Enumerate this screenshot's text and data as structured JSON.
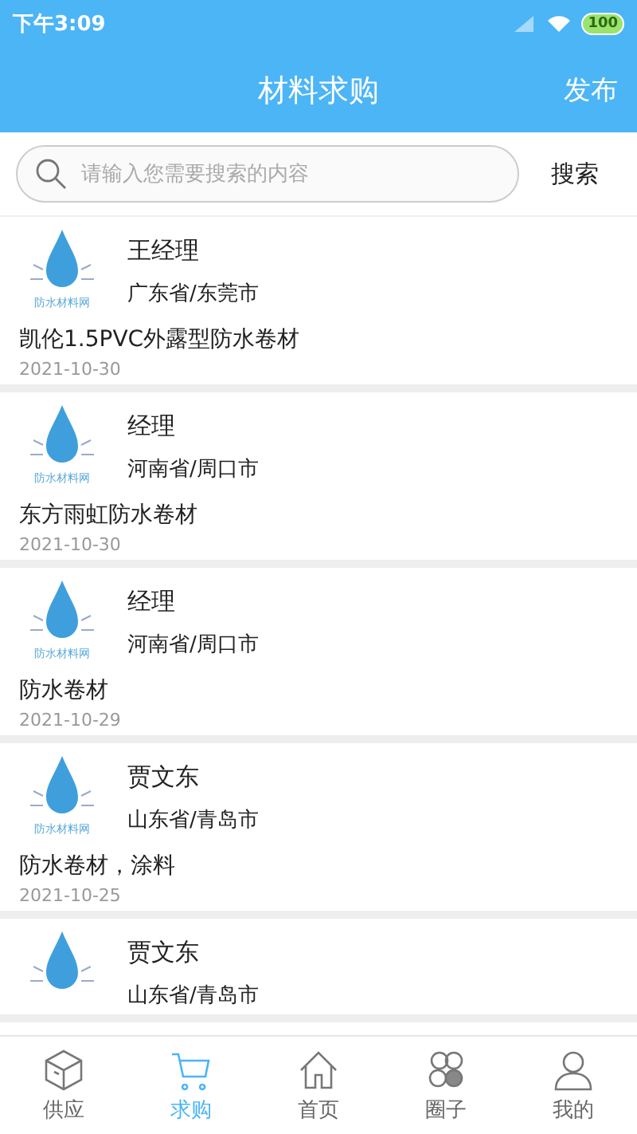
{
  "status_bar": {
    "time": "下午3:09",
    "battery": "100"
  },
  "header": {
    "title": "材料求购",
    "action": "发布"
  },
  "search": {
    "placeholder": "请输入您需要搜索的内容",
    "button": "搜索"
  },
  "posts": [
    {
      "logo_text": "防水材料网",
      "name": "王经理",
      "location": "广东省/东莞市",
      "title": "凯伦1.5PVC外露型防水卷材",
      "date": "2021-10-30"
    },
    {
      "logo_text": "防水材料网",
      "name": "经理",
      "location": "河南省/周口市",
      "title": "东方雨虹防水卷材",
      "date": "2021-10-30"
    },
    {
      "logo_text": "防水材料网",
      "name": "经理",
      "location": "河南省/周口市",
      "title": "防水卷材",
      "date": "2021-10-29"
    },
    {
      "logo_text": "防水材料网",
      "name": "贾文东",
      "location": "山东省/青岛市",
      "title": "防水卷材，涂料",
      "date": "2021-10-25"
    },
    {
      "name": "贾文东",
      "location": "山东省/青岛市"
    }
  ],
  "tab_bar": [
    {
      "kind": "box",
      "label": "供应",
      "selected": false
    },
    {
      "kind": "cart",
      "label": "求购",
      "selected": true
    },
    {
      "kind": "home",
      "label": "首页",
      "selected": false
    },
    {
      "kind": "circles",
      "label": "圈子",
      "selected": false
    },
    {
      "kind": "person",
      "label": "我的",
      "selected": false
    }
  ]
}
